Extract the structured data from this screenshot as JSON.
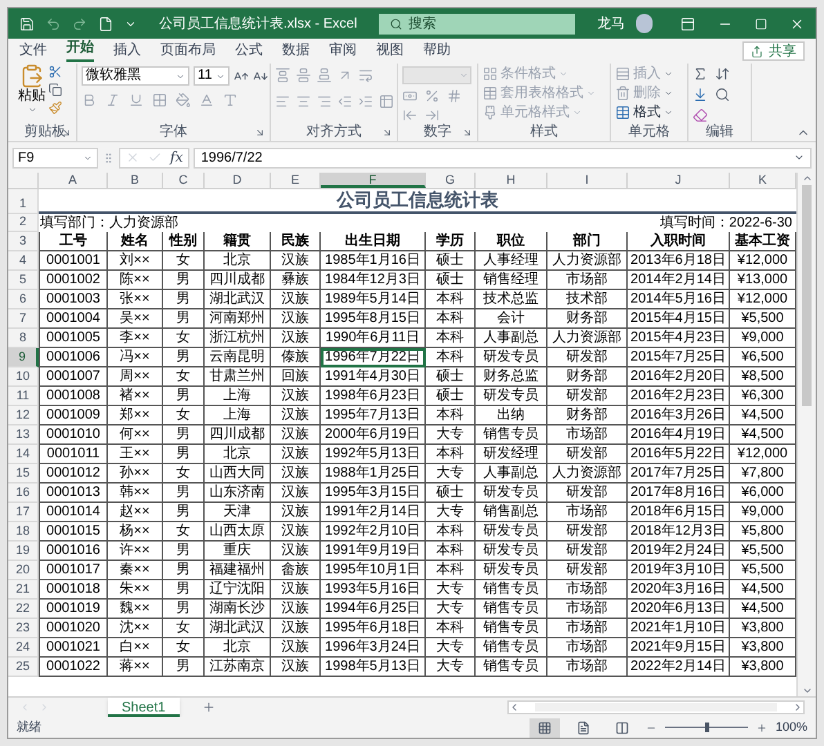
{
  "window": {
    "title": "公司员工信息统计表.xlsx  -  Excel",
    "search_placeholder": "搜索",
    "user": "龙马"
  },
  "ribbon_tabs": [
    {
      "label": "文件",
      "selected": false
    },
    {
      "label": "开始",
      "selected": true
    },
    {
      "label": "插入",
      "selected": false
    },
    {
      "label": "页面布局",
      "selected": false
    },
    {
      "label": "公式",
      "selected": false
    },
    {
      "label": "数据",
      "selected": false
    },
    {
      "label": "审阅",
      "selected": false
    },
    {
      "label": "视图",
      "selected": false
    },
    {
      "label": "帮助",
      "selected": false
    }
  ],
  "share_button": "共享",
  "ribbon": {
    "paste": "粘贴",
    "font_name": "微软雅黑",
    "font_size": "11",
    "styles": [
      {
        "label": "条件格式",
        "disabled": true
      },
      {
        "label": "套用表格格式",
        "disabled": true
      },
      {
        "label": "单元格样式",
        "disabled": true
      }
    ],
    "cells": [
      {
        "label": "插入",
        "disabled": true
      },
      {
        "label": "删除",
        "disabled": true
      },
      {
        "label": "格式",
        "disabled": false
      }
    ],
    "groups": [
      {
        "label": "剪贴板",
        "launcher": true
      },
      {
        "label": "字体",
        "launcher": true
      },
      {
        "label": "对齐方式",
        "launcher": true
      },
      {
        "label": "数字",
        "launcher": true
      },
      {
        "label": "样式",
        "launcher": false
      },
      {
        "label": "单元格",
        "launcher": false
      },
      {
        "label": "编辑",
        "launcher": false
      }
    ]
  },
  "formula_bar": {
    "name_box": "F9",
    "function_label": "fx",
    "value": "1996/7/22"
  },
  "sheet": {
    "columns": [
      {
        "label": "A",
        "selected": false
      },
      {
        "label": "B",
        "selected": false
      },
      {
        "label": "C",
        "selected": false
      },
      {
        "label": "D",
        "selected": false
      },
      {
        "label": "E",
        "selected": false
      },
      {
        "label": "F",
        "selected": true
      },
      {
        "label": "G",
        "selected": false
      },
      {
        "label": "H",
        "selected": false
      },
      {
        "label": "I",
        "selected": false
      },
      {
        "label": "J",
        "selected": false
      },
      {
        "label": "K",
        "selected": false
      }
    ],
    "row_headers": [
      {
        "label": "1",
        "selected": false
      },
      {
        "label": "2",
        "selected": false
      },
      {
        "label": "3",
        "selected": false
      },
      {
        "label": "4",
        "selected": false
      },
      {
        "label": "5",
        "selected": false
      },
      {
        "label": "6",
        "selected": false
      },
      {
        "label": "7",
        "selected": false
      },
      {
        "label": "8",
        "selected": false
      },
      {
        "label": "9",
        "selected": true
      },
      {
        "label": "10",
        "selected": false
      },
      {
        "label": "11",
        "selected": false
      },
      {
        "label": "12",
        "selected": false
      },
      {
        "label": "13",
        "selected": false
      },
      {
        "label": "14",
        "selected": false
      },
      {
        "label": "15",
        "selected": false
      },
      {
        "label": "16",
        "selected": false
      },
      {
        "label": "17",
        "selected": false
      },
      {
        "label": "18",
        "selected": false
      },
      {
        "label": "19",
        "selected": false
      },
      {
        "label": "20",
        "selected": false
      },
      {
        "label": "21",
        "selected": false
      },
      {
        "label": "22",
        "selected": false
      },
      {
        "label": "23",
        "selected": false
      },
      {
        "label": "24",
        "selected": false
      },
      {
        "label": "25",
        "selected": false
      }
    ],
    "title": "公司员工信息统计表",
    "department": "填写部门：人力资源部",
    "fill_date": "填写时间：2022-6-30",
    "table": {
      "columns": [
        "工号",
        "姓名",
        "性别",
        "籍贯",
        "民族",
        "出生日期",
        "学历",
        "职位",
        "部门",
        "入职时间",
        "基本工资"
      ],
      "rows": [
        [
          "0001001",
          "刘××",
          "女",
          "北京",
          "汉族",
          "1985年1月16日",
          "硕士",
          "人事经理",
          "人力资源部",
          "2013年6月18日",
          "¥12,000"
        ],
        [
          "0001002",
          "陈××",
          "男",
          "四川成都",
          "彝族",
          "1984年12月3日",
          "硕士",
          "销售经理",
          "市场部",
          "2014年2月14日",
          "¥13,000"
        ],
        [
          "0001003",
          "张××",
          "男",
          "湖北武汉",
          "汉族",
          "1989年5月14日",
          "本科",
          "技术总监",
          "技术部",
          "2014年5月16日",
          "¥12,000"
        ],
        [
          "0001004",
          "吴××",
          "男",
          "河南郑州",
          "汉族",
          "1995年8月15日",
          "本科",
          "会计",
          "财务部",
          "2015年4月15日",
          "¥5,500"
        ],
        [
          "0001005",
          "李××",
          "女",
          "浙江杭州",
          "汉族",
          "1990年6月11日",
          "本科",
          "人事副总",
          "人力资源部",
          "2015年4月23日",
          "¥9,000"
        ],
        [
          "0001006",
          "冯××",
          "男",
          "云南昆明",
          "傣族",
          "1996年7月22日",
          "本科",
          "研发专员",
          "研发部",
          "2015年7月25日",
          "¥6,500"
        ],
        [
          "0001007",
          "周××",
          "女",
          "甘肃兰州",
          "回族",
          "1991年4月30日",
          "硕士",
          "财务总监",
          "财务部",
          "2016年2月20日",
          "¥8,500"
        ],
        [
          "0001008",
          "褚××",
          "男",
          "上海",
          "汉族",
          "1998年6月23日",
          "硕士",
          "研发专员",
          "研发部",
          "2016年2月23日",
          "¥6,300"
        ],
        [
          "0001009",
          "郑××",
          "女",
          "上海",
          "汉族",
          "1995年7月13日",
          "本科",
          "出纳",
          "财务部",
          "2016年3月26日",
          "¥4,500"
        ],
        [
          "0001010",
          "何××",
          "男",
          "四川成都",
          "汉族",
          "2000年6月19日",
          "大专",
          "销售专员",
          "市场部",
          "2016年4月19日",
          "¥4,500"
        ],
        [
          "0001011",
          "王××",
          "男",
          "北京",
          "汉族",
          "1992年5月13日",
          "本科",
          "研发经理",
          "研发部",
          "2016年5月22日",
          "¥12,000"
        ],
        [
          "0001012",
          "孙××",
          "女",
          "山西大同",
          "汉族",
          "1988年1月25日",
          "大专",
          "人事副总",
          "人力资源部",
          "2017年7月25日",
          "¥7,800"
        ],
        [
          "0001013",
          "韩××",
          "男",
          "山东济南",
          "汉族",
          "1995年3月15日",
          "硕士",
          "研发专员",
          "研发部",
          "2017年8月16日",
          "¥6,000"
        ],
        [
          "0001014",
          "赵××",
          "男",
          "天津",
          "汉族",
          "1991年2月14日",
          "大专",
          "销售副总",
          "市场部",
          "2018年6月15日",
          "¥9,000"
        ],
        [
          "0001015",
          "杨××",
          "女",
          "山西太原",
          "汉族",
          "1992年2月10日",
          "本科",
          "研发专员",
          "研发部",
          "2018年12月3日",
          "¥5,800"
        ],
        [
          "0001016",
          "许××",
          "男",
          "重庆",
          "汉族",
          "1991年9月19日",
          "本科",
          "研发专员",
          "研发部",
          "2019年2月24日",
          "¥5,500"
        ],
        [
          "0001017",
          "秦××",
          "男",
          "福建福州",
          "畲族",
          "1995年10月1日",
          "本科",
          "研发专员",
          "研发部",
          "2019年3月10日",
          "¥5,500"
        ],
        [
          "0001018",
          "朱××",
          "男",
          "辽宁沈阳",
          "汉族",
          "1993年5月16日",
          "大专",
          "销售专员",
          "市场部",
          "2020年3月16日",
          "¥4,500"
        ],
        [
          "0001019",
          "魏××",
          "男",
          "湖南长沙",
          "汉族",
          "1994年6月25日",
          "大专",
          "销售专员",
          "市场部",
          "2020年6月13日",
          "¥4,500"
        ],
        [
          "0001020",
          "沈××",
          "女",
          "湖北武汉",
          "汉族",
          "1995年6月18日",
          "本科",
          "销售专员",
          "市场部",
          "2021年1月10日",
          "¥3,800"
        ],
        [
          "0001021",
          "白××",
          "女",
          "北京",
          "汉族",
          "1996年3月24日",
          "大专",
          "销售专员",
          "市场部",
          "2021年9月15日",
          "¥3,800"
        ],
        [
          "0001022",
          "蒋××",
          "男",
          "江苏南京",
          "汉族",
          "1998年5月13日",
          "大专",
          "销售专员",
          "市场部",
          "2022年2月14日",
          "¥3,800"
        ]
      ]
    }
  },
  "sheet_tabs": [
    {
      "label": "Sheet1",
      "selected": true
    }
  ],
  "status_bar": {
    "status": "就绪",
    "views": [
      {
        "kind": "normal",
        "selected": true
      },
      {
        "kind": "page_layout",
        "selected": false
      },
      {
        "kind": "page_break",
        "selected": false
      }
    ],
    "zoom": {
      "level": 0.5,
      "reading": "100%"
    }
  }
}
